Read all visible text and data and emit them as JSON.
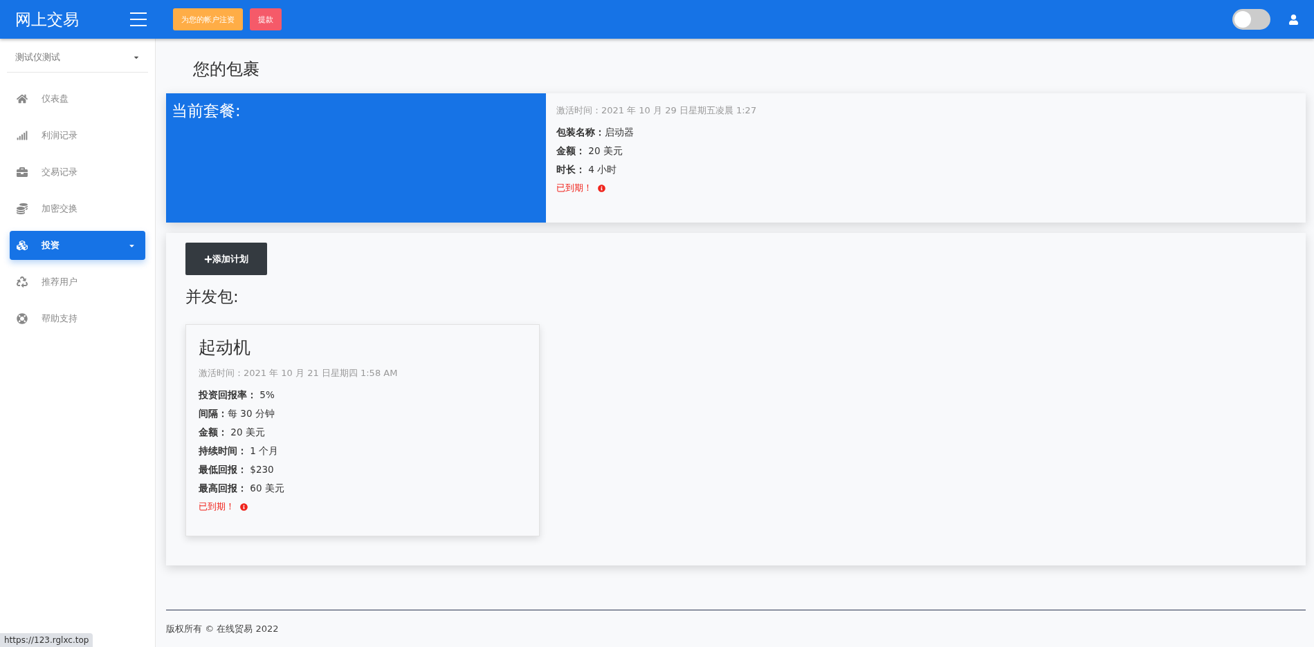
{
  "topbar": {
    "brand": "网上交易",
    "buttons": [
      {
        "label": "为您的帐户注资",
        "kind": "fund"
      },
      {
        "label": "提款",
        "kind": "withdraw"
      }
    ],
    "theme_toggle": {
      "on": false
    }
  },
  "sidebar": {
    "user": "测试仪测试",
    "items": [
      {
        "label": "仪表盘",
        "kind": "link",
        "selected": false
      },
      {
        "label": "利润记录",
        "kind": "link",
        "selected": false
      },
      {
        "label": "交易记录",
        "kind": "link",
        "selected": false
      },
      {
        "label": "加密交换",
        "kind": "link",
        "selected": false
      },
      {
        "label": "投资",
        "kind": "dropdown",
        "selected": true
      },
      {
        "label": "推荐用户",
        "kind": "link",
        "selected": false
      },
      {
        "label": "帮助支持",
        "kind": "link",
        "selected": false
      }
    ]
  },
  "page_title": "您的包裹",
  "current_plan": {
    "heading": "当前套餐:",
    "activated": "激活时间：2021 年 10 月 29 日星期五凌晨 1:27",
    "fields": [
      {
        "label": "包装名称：",
        "value": "启动器"
      },
      {
        "label": "金额：",
        "value": " 20 美元"
      },
      {
        "label": "时长：",
        "value": " 4 小时"
      }
    ],
    "status": "已到期！"
  },
  "add_plan_button": "添加计划",
  "section_title": "并发包:",
  "packages": [
    {
      "name": "起动机",
      "activated": "激活时间：2021 年 10 月 21 日星期四 1:58 AM",
      "fields": [
        {
          "label": "投资回报率：",
          "value": " 5%"
        },
        {
          "label": "间隔：",
          "value": "每 30 分钟"
        },
        {
          "label": "金额：",
          "value": " 20 美元"
        },
        {
          "label": "持续时间：",
          "value": " 1 个月"
        },
        {
          "label": "最低回报：",
          "value": " $230"
        },
        {
          "label": "最高回报：",
          "value": " 60 美元"
        }
      ],
      "status": "已到期！"
    }
  ],
  "footer": "版权所有 © 在线贸易 2022",
  "status_url": "https://123.rglxc.top"
}
